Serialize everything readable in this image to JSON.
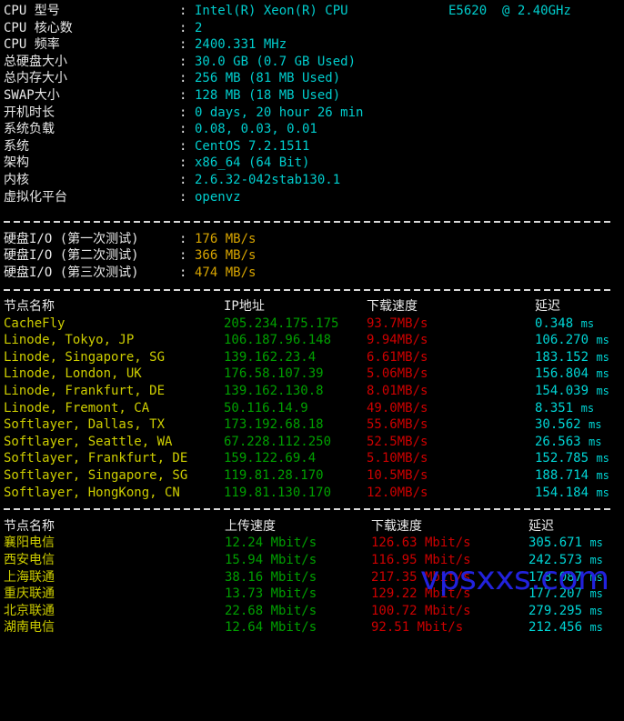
{
  "terminal": {
    "background": "#000000",
    "colors": {
      "label": "#e8e8e8",
      "value": "#00cdcd",
      "disk_io": "#d7a400",
      "node_name": "#cdcd00",
      "ip": "#00a000",
      "speed": "#cd0000",
      "latency": "#00d5d5",
      "watermark": "#2222dd"
    }
  },
  "system_info": {
    "separator_char": "-",
    "colon": ":",
    "rows": [
      {
        "label": "CPU 型号",
        "value": "Intel(R) Xeon(R) CPU",
        "value2": "E5620  @ 2.40GHz"
      },
      {
        "label": "CPU 核心数",
        "value": "2",
        "value2": ""
      },
      {
        "label": "CPU 频率",
        "value": "2400.331 MHz",
        "value2": ""
      },
      {
        "label": "总硬盘大小",
        "value": "30.0 GB (0.7 GB Used)",
        "value2": ""
      },
      {
        "label": "总内存大小",
        "value": "256 MB (81 MB Used)",
        "value2": ""
      },
      {
        "label": "SWAP大小",
        "value": "128 MB (18 MB Used)",
        "value2": ""
      },
      {
        "label": "开机时长",
        "value": "0 days, 20 hour 26 min",
        "value2": ""
      },
      {
        "label": "系统负载",
        "value": "0.08, 0.03, 0.01",
        "value2": ""
      },
      {
        "label": "系统",
        "value": "CentOS 7.2.1511",
        "value2": ""
      },
      {
        "label": "架构",
        "value": "x86_64 (64 Bit)",
        "value2": ""
      },
      {
        "label": "内核",
        "value": "2.6.32-042stab130.1",
        "value2": ""
      },
      {
        "label": "虚拟化平台",
        "value": "openvz",
        "value2": ""
      }
    ]
  },
  "disk_io": {
    "rows": [
      {
        "label": "硬盘I/O (第一次测试)",
        "colon": ":",
        "value": "176 MB/s"
      },
      {
        "label": "硬盘I/O (第二次测试)",
        "colon": ":",
        "value": "366 MB/s"
      },
      {
        "label": "硬盘I/O (第三次测试)",
        "colon": ":",
        "value": "474 MB/s"
      }
    ]
  },
  "speedtest_global": {
    "headers": {
      "name": "节点名称",
      "ip": "IP地址",
      "download": "下载速度",
      "latency": "延迟"
    },
    "unit_suffix": "ms",
    "rows": [
      {
        "name": "CacheFly",
        "ip": "205.234.175.175",
        "download": "93.7MB/s",
        "latency": "0.348"
      },
      {
        "name": "Linode, Tokyo, JP",
        "ip": "106.187.96.148",
        "download": "9.94MB/s",
        "latency": "106.270"
      },
      {
        "name": "Linode, Singapore, SG",
        "ip": "139.162.23.4",
        "download": "6.61MB/s",
        "latency": "183.152"
      },
      {
        "name": "Linode, London, UK",
        "ip": "176.58.107.39",
        "download": "5.06MB/s",
        "latency": "156.804"
      },
      {
        "name": "Linode, Frankfurt, DE",
        "ip": "139.162.130.8",
        "download": "8.01MB/s",
        "latency": "154.039"
      },
      {
        "name": "Linode, Fremont, CA",
        "ip": "50.116.14.9",
        "download": "49.0MB/s",
        "latency": "8.351"
      },
      {
        "name": "Softlayer, Dallas, TX",
        "ip": "173.192.68.18",
        "download": "55.6MB/s",
        "latency": "30.562"
      },
      {
        "name": "Softlayer, Seattle, WA",
        "ip": "67.228.112.250",
        "download": "52.5MB/s",
        "latency": "26.563"
      },
      {
        "name": "Softlayer, Frankfurt, DE",
        "ip": "159.122.69.4",
        "download": "5.10MB/s",
        "latency": "152.785"
      },
      {
        "name": "Softlayer, Singapore, SG",
        "ip": "119.81.28.170",
        "download": "10.5MB/s",
        "latency": "188.714"
      },
      {
        "name": "Softlayer, HongKong, CN",
        "ip": "119.81.130.170",
        "download": "12.0MB/s",
        "latency": "154.184"
      }
    ]
  },
  "speedtest_china": {
    "headers": {
      "name": "节点名称",
      "upload": "上传速度",
      "download": "下载速度",
      "latency": "延迟"
    },
    "unit_suffix": "ms",
    "rows": [
      {
        "name": "襄阳电信",
        "upload": "12.24 Mbit/s",
        "download": "126.63 Mbit/s",
        "latency": "305.671"
      },
      {
        "name": "西安电信",
        "upload": "15.94 Mbit/s",
        "download": "116.95 Mbit/s",
        "latency": "242.573"
      },
      {
        "name": "上海联通",
        "upload": "38.16 Mbit/s",
        "download": "217.35 Mbit/s",
        "latency": "178.087"
      },
      {
        "name": "重庆联通",
        "upload": "13.73 Mbit/s",
        "download": "129.22 Mbit/s",
        "latency": "177.207"
      },
      {
        "name": "北京联通",
        "upload": "22.68 Mbit/s",
        "download": "100.72 Mbit/s",
        "latency": "279.295"
      },
      {
        "name": "湖南电信",
        "upload": "12.64 Mbit/s",
        "download": "92.51 Mbit/s",
        "latency": "212.456"
      }
    ]
  },
  "watermark": {
    "text": "vpsxxs.com"
  }
}
